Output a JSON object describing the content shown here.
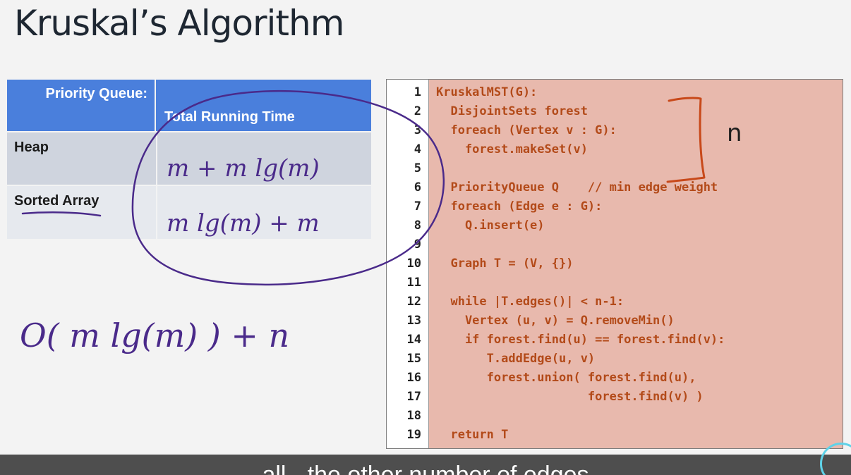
{
  "slide": {
    "title": "Kruskal’s Algorithm"
  },
  "table": {
    "header_col1": "Priority Queue:",
    "header_col2": "Total Running Time",
    "rows": [
      {
        "label": "Heap"
      },
      {
        "label": "Sorted Array"
      }
    ]
  },
  "code": {
    "lines": [
      {
        "num": "1",
        "text": "KruskalMST(G):"
      },
      {
        "num": "2",
        "text": "  DisjointSets forest"
      },
      {
        "num": "3",
        "text": "  foreach (Vertex v : G):"
      },
      {
        "num": "4",
        "text": "    forest.makeSet(v)"
      },
      {
        "num": "5",
        "text": ""
      },
      {
        "num": "6",
        "text": "  PriorityQueue Q    // min edge weight"
      },
      {
        "num": "7",
        "text": "  foreach (Edge e : G):"
      },
      {
        "num": "8",
        "text": "    Q.insert(e)"
      },
      {
        "num": "9",
        "text": ""
      },
      {
        "num": "10",
        "text": "  Graph T = (V, {})"
      },
      {
        "num": "11",
        "text": ""
      },
      {
        "num": "12",
        "text": "  while |T.edges()| < n-1:"
      },
      {
        "num": "13",
        "text": "    Vertex (u, v) = Q.removeMin()"
      },
      {
        "num": "14",
        "text": "    if forest.find(u) == forest.find(v):"
      },
      {
        "num": "15",
        "text": "       T.addEdge(u, v)"
      },
      {
        "num": "16",
        "text": "       forest.union( forest.find(u),"
      },
      {
        "num": "17",
        "text": "                     forest.find(v) )"
      },
      {
        "num": "18",
        "text": ""
      },
      {
        "num": "19",
        "text": "  return T"
      }
    ]
  },
  "handwriting": {
    "heap_cell": "m + m lg(m)",
    "sorted_array_cell": "m lg(m) + m",
    "big_o": "O( m lg(m) ) + n",
    "bracket_label": "n",
    "ink_color_orange": "#c8491a",
    "ink_color_purple": "#4a2a8a",
    "ink_color_black": "#1e1e1e"
  },
  "caption": {
    "text": "...all - the other number of edges..."
  },
  "colors": {
    "table_header": "#4a7fdc",
    "code_background": "#e8b9ad",
    "code_text": "#b34a19",
    "caption_bar": "#4e4e4e"
  }
}
